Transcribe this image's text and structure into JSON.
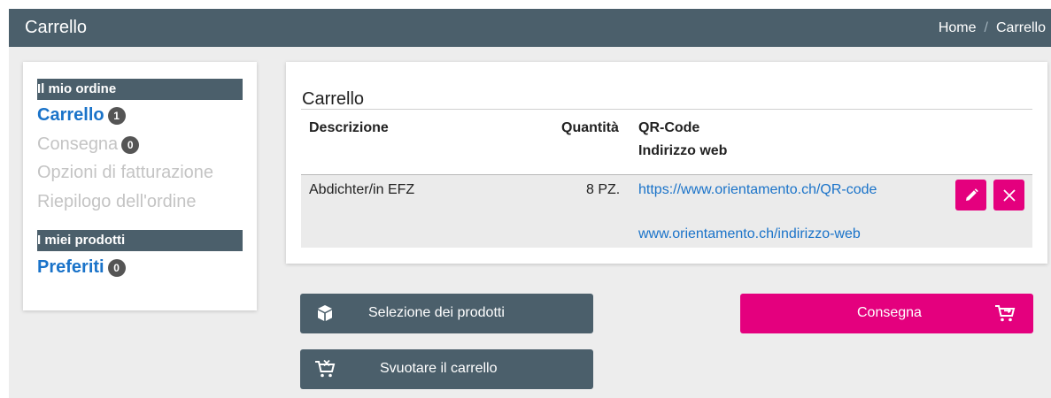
{
  "header": {
    "title": "Carrello",
    "breadcrumb": [
      "Home",
      "Carrello"
    ],
    "breadcrumb_separator": "/"
  },
  "sidebar": {
    "order_heading": "Il mio ordine",
    "steps": [
      {
        "label": "Carrello",
        "badge": "1",
        "state": "active"
      },
      {
        "label": "Consegna",
        "badge": "0",
        "state": "disabled"
      },
      {
        "label": "Opzioni di fatturazione",
        "state": "disabled"
      },
      {
        "label": "Riepilogo dell'ordine",
        "state": "disabled"
      }
    ],
    "products_heading": "I miei prodotti",
    "favorites": {
      "label": "Preferiti",
      "badge": "0"
    }
  },
  "cart": {
    "title": "Carrello",
    "columns": {
      "description": "Descrizione",
      "quantity": "Quantità",
      "qr": "QR-Code",
      "web": "Indirizzo web"
    },
    "rows": [
      {
        "description": "Abdichter/in EFZ",
        "quantity": "8 PZ.",
        "qr_url": "https://www.orientamento.ch/QR-code",
        "web_url": "www.orientamento.ch/indirizzo-web",
        "actions": [
          "pencil-icon",
          "close-icon"
        ]
      }
    ]
  },
  "buttons": {
    "select_products": "Selezione dei prodotti",
    "checkout": "Consegna",
    "empty_cart": "Svuotare il carrello"
  },
  "colors": {
    "header_bg": "#4b5f6b",
    "accent_pink": "#e4007e",
    "link_blue": "#1a73c9",
    "page_bg": "#ededed"
  }
}
